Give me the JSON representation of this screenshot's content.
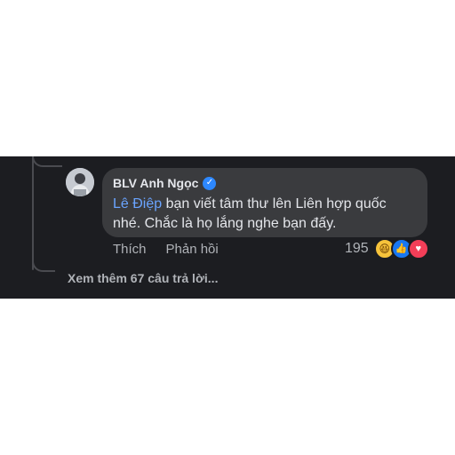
{
  "comment": {
    "author": "BLV Anh Ngọc",
    "mention": "Lê Điệp",
    "text_line1": " bạn viết tâm thư lên Liên hợp quốc",
    "text_line2": "nhé. Chắc là họ lắng nghe bạn đấy.",
    "verified_icon": "verified-check-icon"
  },
  "actions": {
    "like_label": "Thích",
    "reply_label": "Phản hồi"
  },
  "reactions": {
    "count": "195",
    "icons": [
      "haha-icon",
      "like-icon",
      "love-icon"
    ]
  },
  "more_replies": "Xem thêm 67 câu trả lời...",
  "colors": {
    "panel_bg": "#1c1d21",
    "bubble_bg": "#3a3b3e",
    "mention": "#6aa4ff",
    "verified": "#2d88ff"
  }
}
